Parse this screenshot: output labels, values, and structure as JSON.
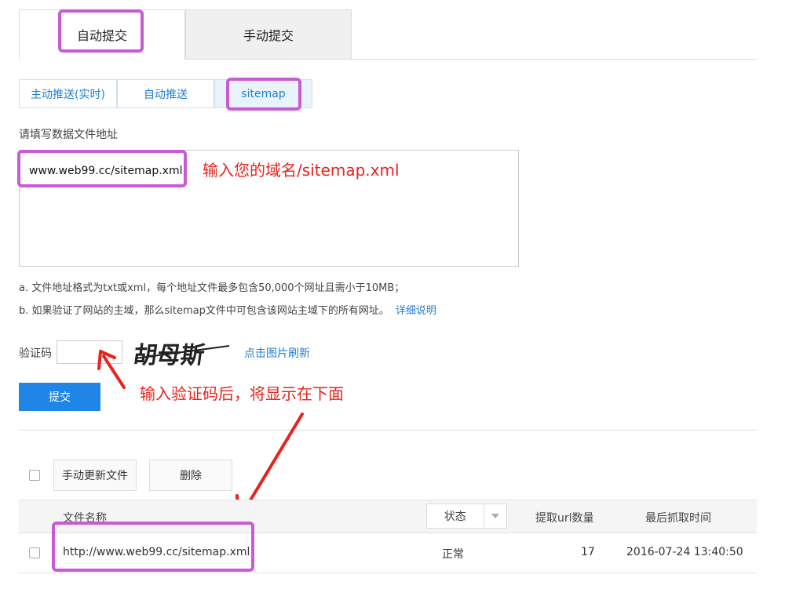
{
  "top_tabs": [
    {
      "label": "自动提交",
      "active": true
    },
    {
      "label": "手动提交",
      "active": false
    }
  ],
  "sub_tabs": [
    {
      "label": "主动推送(实时)"
    },
    {
      "label": "自动推送"
    },
    {
      "label": "sitemap",
      "active": true
    }
  ],
  "form": {
    "label": "请填写数据文件地址",
    "textarea_value": "www.web99.cc/sitemap.xml",
    "annotation": "输入您的域名/sitemap.xml",
    "note_a": "a. 文件地址格式为txt或xml，每个地址文件最多包含50,000个网址且需小于10MB；",
    "note_b": "b. 如果验证了网站的主域，那么sitemap文件中可包含该网站主域下的所有网址。",
    "note_b_link": "详细说明"
  },
  "captcha": {
    "label": "验证码",
    "image_text": "胡母斯",
    "refresh_link": "点击图片刷新",
    "annotation": "输入验证码后，将显示在下面"
  },
  "submit_label": "提交",
  "toolbar": {
    "update_button": "手动更新文件",
    "delete_button": "删除"
  },
  "table": {
    "columns": {
      "filename": "文件名称",
      "status": "状态",
      "url_count": "提取url数量",
      "last_crawl": "最后抓取时间"
    },
    "rows": [
      {
        "filename": "http://www.web99.cc/sitemap.xml",
        "status": "正常",
        "url_count": "17",
        "last_crawl": "2016-07-24 13:40:50"
      }
    ]
  },
  "colors": {
    "accent_blue": "#1f85e6",
    "link_blue": "#1f7ed0",
    "highlight_purple": "#c85ad6",
    "annotation_red": "#e8231e"
  }
}
